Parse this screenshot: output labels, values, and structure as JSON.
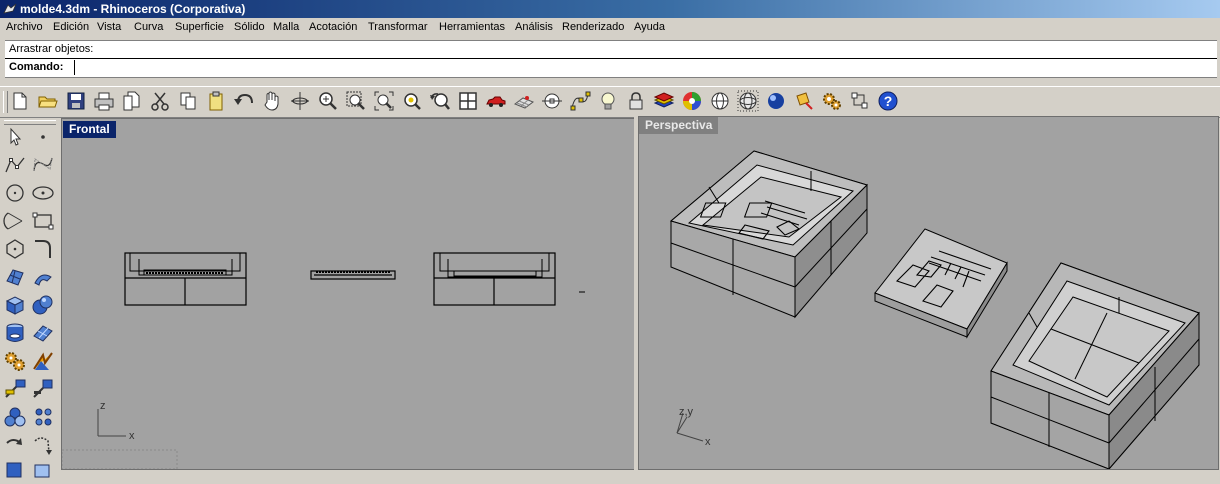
{
  "window": {
    "title": "molde4.3dm - Rhinoceros (Corporativa)"
  },
  "menu": [
    "Archivo",
    "Edición",
    "Vista",
    "Curva",
    "Superficie",
    "Sólido",
    "Malla",
    "Acotación",
    "Transformar",
    "Herramientas",
    "Análisis",
    "Renderizado",
    "Ayuda"
  ],
  "command": {
    "history": "Arrastrar objetos:",
    "label": "Comando:",
    "value": ""
  },
  "toolbar_icons": [
    "new-file-icon",
    "open-folder-icon",
    "save-icon",
    "print-icon",
    "paste-document-icon",
    "cut-icon",
    "copy-icon",
    "clipboard-icon",
    "undo-icon",
    "pan-hand-icon",
    "rotate-view-icon",
    "zoom-dynamic-icon",
    "zoom-window-icon",
    "zoom-extents-icon",
    "zoom-selected-icon",
    "undo-view-icon",
    "four-viewports-icon",
    "car-icon",
    "grid-plane-icon",
    "object-snap-icon",
    "points-on-icon",
    "light-bulb-icon",
    "lock-icon",
    "layers-icon",
    "color-wheel-icon",
    "wireframe-sphere-icon",
    "render-mesh-sphere-icon",
    "shaded-sphere-icon",
    "render-light-icon",
    "settings-gears-icon",
    "properties-icon",
    "help-icon"
  ],
  "left_toolbar_icons": [
    [
      "select-arrow-icon",
      "point-icon"
    ],
    [
      "polyline-icon",
      "curve-icon"
    ],
    [
      "circle-icon",
      "ellipse-icon"
    ],
    [
      "arc-icon",
      "rectangle-icon"
    ],
    [
      "polygon-icon",
      "fillet-curve-icon"
    ],
    [
      "surface-from-points-icon",
      "extrude-surface-icon"
    ],
    [
      "box-icon",
      "boolean-union-icon"
    ],
    [
      "cylinder-icon",
      "surface-patch-icon"
    ],
    [
      "explode-icon",
      "trim-icon"
    ],
    [
      "split-icon",
      "join-icon"
    ],
    [
      "group-icon",
      "array-icon"
    ],
    [
      "move-icon",
      "rotate-icon"
    ]
  ],
  "viewports": {
    "front": {
      "label": "Frontal",
      "axis_v": "z",
      "axis_h": "x"
    },
    "perspective": {
      "label": "Perspectiva",
      "axis_v": "z,y",
      "axis_h": "x"
    }
  }
}
